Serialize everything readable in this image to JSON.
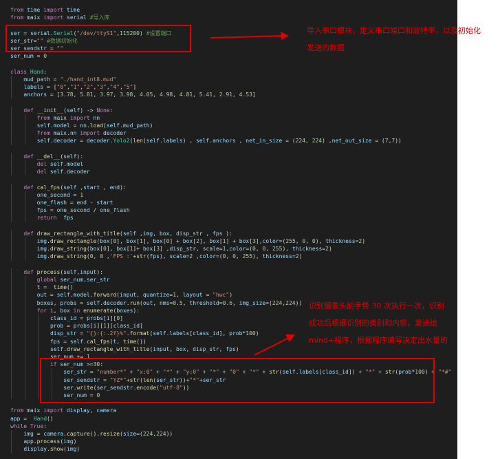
{
  "colors": {
    "background": "#1e1e1e",
    "keyword": "#c586c0",
    "identifier": "#9cdcfe",
    "function": "#dcdcaa",
    "string": "#ce9178",
    "number": "#b5cea8",
    "comment": "#6a9955",
    "plain": "#d4d4d4",
    "class_name": "#4ec9b0",
    "annotation": "#e00000"
  },
  "code_lines": [
    "from time import time",
    "from maix import serial #导入库",
    "",
    "ser = serial.Serial(\"/dev/ttyS1\",115200) #设置端口",
    "ser_str=\"\" #数据初始化",
    "ser_sendstr = \"\"",
    "ser_num = 0",
    "",
    "class Hand:",
    "    mud_path = \"./hand_int8.mud\"",
    "    labels = [\"0\",\"1\",\"2\",\"3\",\"4\",\"5\"]",
    "    anchors = [3.78, 5.81, 3.97, 3.98, 4.05, 4.98, 4.81, 5.41, 2.91, 4.53]",
    "",
    "    def __init__(self) -> None:",
    "        from maix import nn",
    "        self.model = nn.load(self.mud_path)",
    "        from maix.nn import decoder",
    "        self.decoder = decoder.Yolo2(len(self.labels) , self.anchors , net_in_size = (224, 224) ,net_out_size = (7,7))",
    "",
    "    def __del__(self):",
    "        del self.model",
    "        del self.decoder",
    "",
    "    def cal_fps(self ,start , end):",
    "        one_second = 1",
    "        one_flash = end - start",
    "        fps = one_second / one_flash",
    "        return  fps",
    "",
    "    def draw_rectangle_with_title(self ,img, box, disp_str , fps ):",
    "        img.draw_rectangle(box[0], box[1], box[0] + box[2], box[1] + box[3],color=(255, 0, 0), thickness=2)",
    "        img.draw_string(box[0], box[1]+ box[3] ,disp_str, scale=1,color=(0, 0, 255), thickness=2)",
    "        img.draw_string(0, 0 ,'FPS :'+str(fps), scale=2 ,color=(0, 0, 255), thickness=2)",
    "",
    "    def process(self,input):",
    "        global ser_num,ser_str",
    "        t =  time()",
    "        out = self.model.forward(input, quantize=1, layout = \"hwc\")",
    "        boxes, probs = self.decoder.run(out, nms=0.5, threshold=0.6, img_size=(224,224))",
    "        for i, box in enumerate(boxes):",
    "            class_id = probs[i][0]",
    "            prob = probs[i][1][class_id]",
    "            disp_str = \"{}:{:.2f}%\".format(self.labels[class_id], prob*100)",
    "            fps = self.cal_fps(t, time())",
    "            self.draw_rectangle_with_title(input, box, disp_str, fps)",
    "            ser_num += 1",
    "            if ser_num >=30:",
    "                ser_str = \"number*\" + \"x:0\" + \"*\" + \"y:0\" + \"*\" + \"0\" + \"*\" + str(self.labels[class_id]) + \"*\" + str(prob*100) + \"*#\"",
    "                ser_sendstr = \"YZ*\"+str(len(ser_str))+\"*\"+ser_str",
    "                ser.write(ser_sendstr.encode(\"utf-8\"))",
    "                ser_num = 0",
    "",
    "from maix import display, camera",
    "app =  Hand()",
    "while True:",
    "    img = camera.capture().resize(size=(224,224))",
    "    app.process(img)",
    "    display.show(img)"
  ],
  "annotations": {
    "top_line1": "导入串口模块，定义串口端口和波特率，以及初始化",
    "top_line2": "发送的数据",
    "bottom_line1": "识别摄像头前手势 30 次执行一次，识别",
    "bottom_line2": "成功后根据识别的类别和内容，发送给",
    "bottom_line3": "mind+程序，根据程序编写决定出水量的"
  }
}
